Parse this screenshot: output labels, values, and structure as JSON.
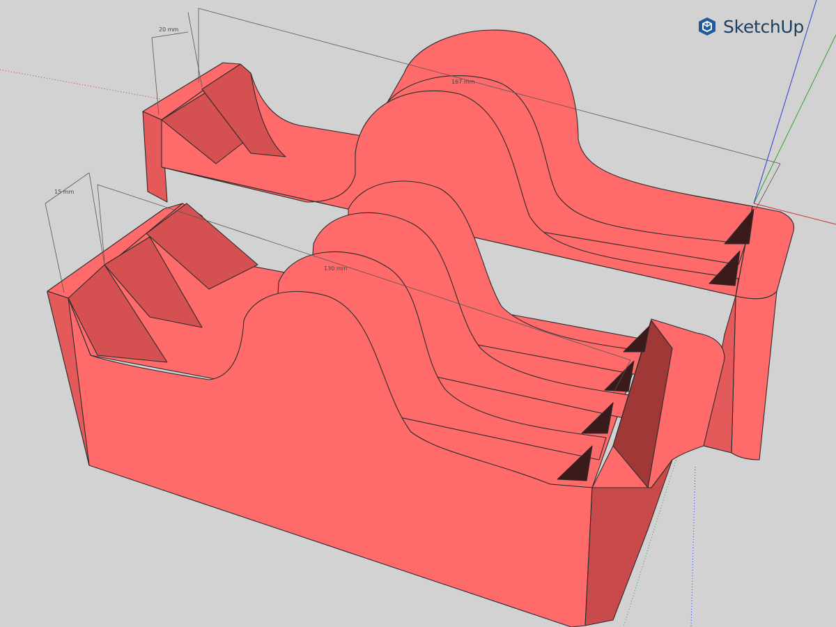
{
  "app": {
    "logo_text": "SketchUp",
    "logo_icon": "sketchup-logo-icon"
  },
  "colors": {
    "background": "#d2d2d2",
    "model_face": "#ff6b6b",
    "model_shadow": "#d55050",
    "model_dark": "#a03838",
    "edge": "#2a2a2a",
    "axis_red": "#d03030",
    "axis_green": "#2ea02e",
    "axis_blue": "#2a3ad8",
    "logo_blue": "#1f5a9a"
  },
  "dimensions": [
    {
      "id": "dim-167",
      "label": "167 mm"
    },
    {
      "id": "dim-130",
      "label": "130 mm"
    },
    {
      "id": "dim-20",
      "label": "20 mm"
    },
    {
      "id": "dim-15",
      "label": "15 mm"
    }
  ]
}
